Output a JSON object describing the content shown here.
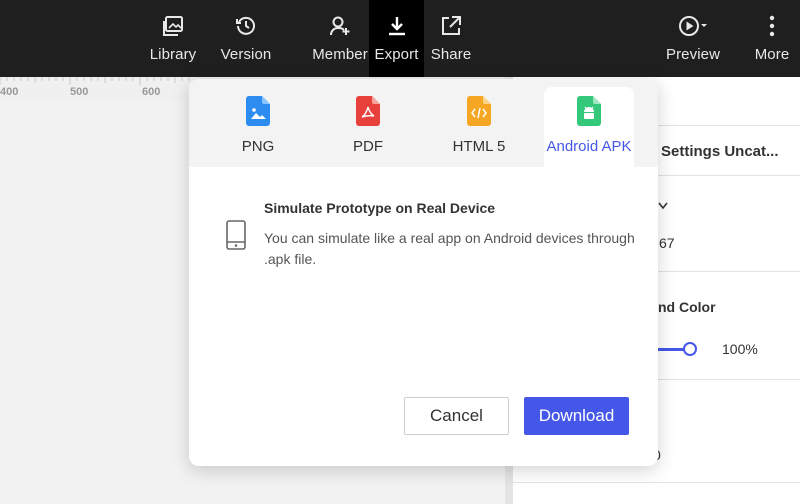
{
  "toolbar": {
    "library": "Library",
    "version": "Version",
    "member": "Member",
    "export": "Export",
    "share": "Share",
    "preview": "Preview",
    "more": "More"
  },
  "ruler": {
    "ticks": [
      "400",
      "500",
      "600"
    ]
  },
  "right_panel": {
    "settings_heading": "Settings Uncat...",
    "value_67": "67",
    "bg_color_label": "nd Color",
    "percent": "100%",
    "value_0": "0"
  },
  "dialog": {
    "tabs": [
      {
        "label": "PNG",
        "icon": "png-file-icon"
      },
      {
        "label": "PDF",
        "icon": "pdf-file-icon"
      },
      {
        "label": "HTML 5",
        "icon": "html5-file-icon"
      },
      {
        "label": "Android APK",
        "icon": "android-file-icon"
      }
    ],
    "active_tab": "Android APK",
    "title": "Simulate Prototype on Real Device",
    "description": "You can simulate like a real app on Android devices through .apk file.",
    "cancel": "Cancel",
    "download": "Download"
  },
  "colors": {
    "accent": "#4457e8",
    "toolbar": "#1f1f1f",
    "png": "#2d8cf0",
    "pdf": "#e8403b",
    "html5": "#f5a623",
    "android": "#34c97a"
  }
}
